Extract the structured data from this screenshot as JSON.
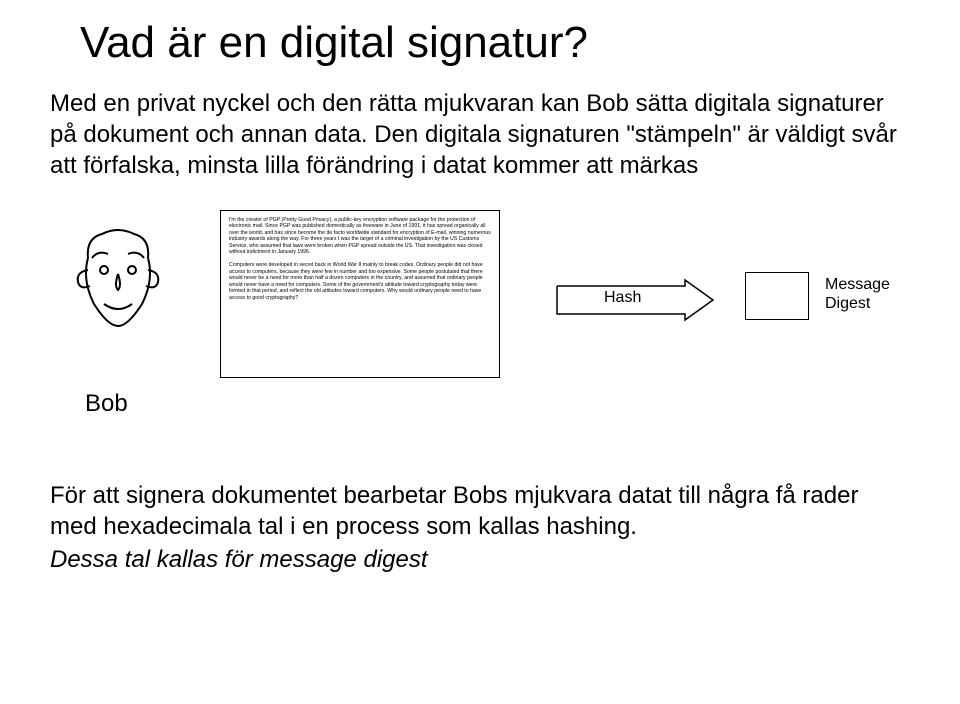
{
  "title": "Vad är en digital signatur?",
  "intro": "Med en privat nyckel och den rätta mjukvaran kan Bob sätta digitala signaturer på dokument och annan data. Den digitala signaturen \"stämpeln\" är väldigt svår att förfalska, minsta lilla förändring i datat kommer att märkas",
  "diagram": {
    "bob_label": "Bob",
    "hash_label": "Hash",
    "digest_label_line1": "Message",
    "digest_label_line2": "Digest",
    "doc_text": "I'm the creator of PGP (Pretty Good Privacy), a public-key encryption software package for the protection of electronic mail. Since PGP was published domestically as freeware in June of 1991, it has spread organically all over the world, and has since become the de facto worldwide standard for encryption of E-mail, winning numerous industry awards along the way. For three years I was the target of a criminal investigation by the US Customs Service, who assumed that laws were broken when PGP spread outside the US. That investigation was closed without indictment in January 1996.\n\nComputers were developed in secret back in World War II mainly to break codes. Ordinary people did not have access to computers, because they were few in number and too expensive. Some people postulated that there would never be a need for more than half a dozen computers in the country, and assumed that ordinary people would never have a need for computers. Some of the government's attitude toward cryptography today were formed in that period, and reflect the old attitudes toward computers. Why would ordinary people need to have access to good cryptography?"
  },
  "outro_line1": "För att signera dokumentet bearbetar Bobs mjukvara datat till några få rader med hexadecimala tal i en process som kallas hashing.",
  "outro_line2": "Dessa tal kallas för message digest"
}
